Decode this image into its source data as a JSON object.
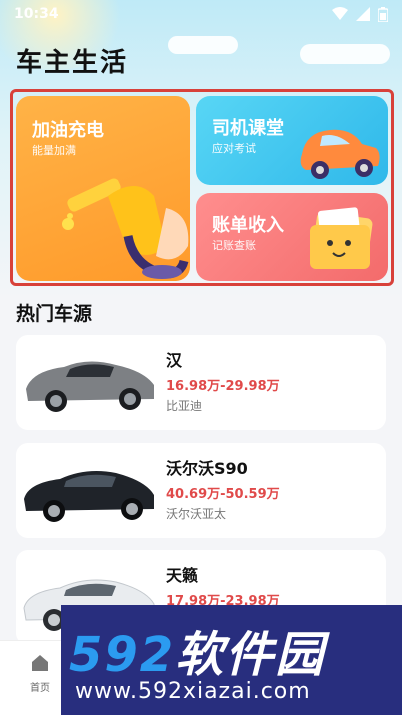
{
  "status_bar": {
    "time": "10:34"
  },
  "page_title": "车主生活",
  "features": {
    "fuel": {
      "title": "加油充电",
      "subtitle": "能量加满"
    },
    "driver": {
      "title": "司机课堂",
      "subtitle": "应对考试"
    },
    "bill": {
      "title": "账单收入",
      "subtitle": "记账查账"
    }
  },
  "section": {
    "title": "热门车源"
  },
  "cars": [
    {
      "name": "汉",
      "price": "16.98万-29.98万",
      "brand": "比亚迪",
      "color": "#7d8084"
    },
    {
      "name": "沃尔沃S90",
      "price": "40.69万-50.59万",
      "brand": "沃尔沃亚太",
      "color": "#1f2329"
    },
    {
      "name": "天籁",
      "price": "17.98万-23.98万",
      "brand": "",
      "color": "#e9ecef"
    }
  ],
  "tab_bar": {
    "home_label": "首页"
  },
  "watermark": {
    "brand_digits": "592",
    "brand_text": "软件园",
    "url": "www.592xiazai.com"
  },
  "colors": {
    "accent_red": "#e04a4a",
    "fuel_card": "#ff9a2a",
    "driver_card": "#2fb8ea",
    "bill_card": "#f36b6b"
  }
}
